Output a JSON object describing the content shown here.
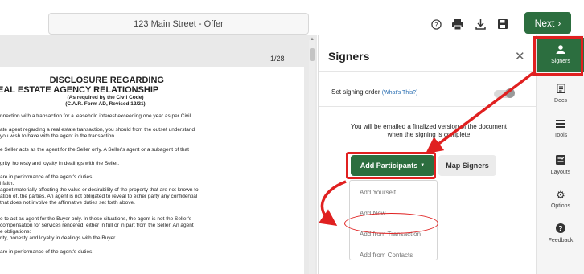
{
  "topbar": {
    "document_title": "123 Main Street - Offer",
    "icons": [
      "help-icon",
      "print-icon",
      "download-icon",
      "save-icon"
    ],
    "next_label": "Next"
  },
  "viewer": {
    "page_counter": "1/28",
    "doc": {
      "heading_1": "DISCLOSURE REGARDING",
      "heading_2": "EAL ESTATE AGENCY RELATIONSHIP",
      "sub_1": "(As required by the Civil Code)",
      "sub_2": "(C.A.R. Form AD, Revised 12/21)",
      "lines": [
        "nnection with a transaction for a leasehold interest exceeding one year as per Civil",
        "ate agent regarding a real estate transaction, you should from the outset understand",
        "you wish to have with the agent in the transaction.",
        "e Seller acts as the agent for the Seller only. A Seller's agent or a subagent of that",
        "grity, honesty and loyalty in dealings with the Seller.",
        "are in performance of the agent's duties.",
        "l faith.",
        "agent materially affecting the value or desirability of the property that are not known to,",
        "ation of, the parties. An agent is not obligated to reveal to either party any confidential",
        "that does not involve the affirmative duties set forth above.",
        "e to act as agent for the Buyer only. In these situations, the agent is not the Seller's",
        "compensation for services rendered, either in full or in part from the Seller. An agent",
        "e obligations:",
        "rity, honesty and loyalty in dealings with the Buyer.",
        "are in performance of the agent's duties."
      ]
    }
  },
  "panel": {
    "title": "Signers",
    "signing_order_label": "Set signing order",
    "whats_this": "(What's This?)",
    "notice_line_1": "You will be emailed a finalized version of the document",
    "notice_line_2": "when the signing is complete",
    "add_participants_label": "Add Participants",
    "map_signers_label": "Map Signers",
    "dropdown_items": [
      "Add Yourself",
      "Add New",
      "Add from Transaction",
      "Add from Contacts"
    ]
  },
  "rightnav": {
    "items": [
      {
        "label": "Signers",
        "icon": "user-icon",
        "glyph": "👤",
        "active": true
      },
      {
        "label": "Docs",
        "icon": "docs-icon",
        "glyph": "▤",
        "active": false
      },
      {
        "label": "Tools",
        "icon": "tools-icon",
        "glyph": "☰",
        "active": false
      },
      {
        "label": "Layouts",
        "icon": "layouts-icon",
        "glyph": "▦",
        "active": false
      },
      {
        "label": "Options",
        "icon": "gear-icon",
        "glyph": "⚙",
        "active": false
      },
      {
        "label": "Feedback",
        "icon": "help-icon",
        "glyph": "?",
        "active": false
      }
    ]
  },
  "colors": {
    "brand_green": "#2c6e3f",
    "annotation_red": "#e02020"
  }
}
